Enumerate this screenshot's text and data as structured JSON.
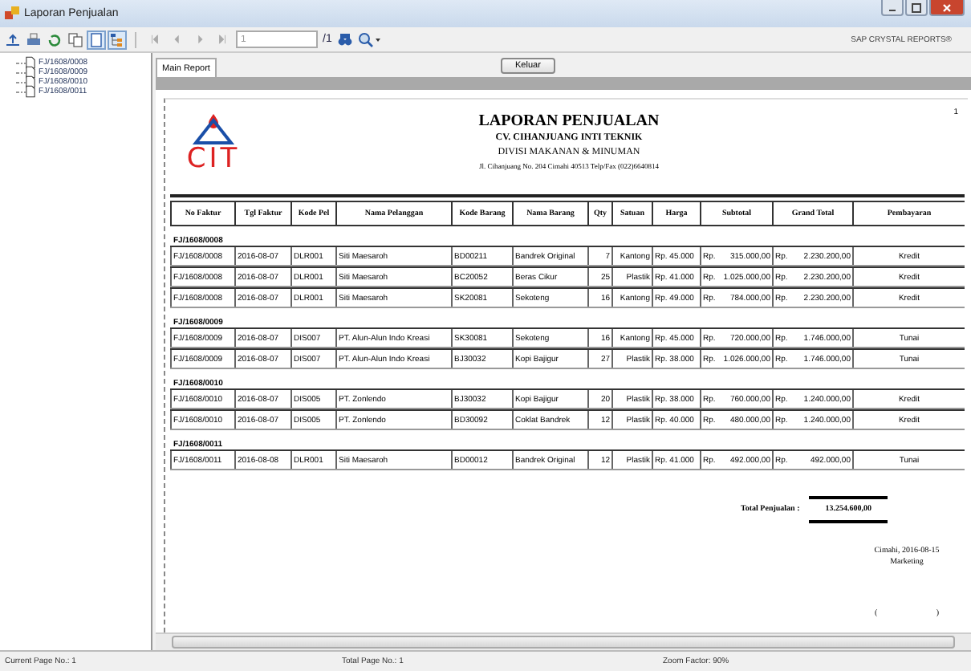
{
  "window": {
    "title": "Laporan Penjualan"
  },
  "toolbar": {
    "page_input": "1",
    "page_total": "/1",
    "brand": "SAP CRYSTAL REPORTS®"
  },
  "tree": [
    {
      "label": "FJ/1608/0008"
    },
    {
      "label": "FJ/1608/0009"
    },
    {
      "label": "FJ/1608/0010"
    },
    {
      "label": "FJ/1608/0011"
    }
  ],
  "tabs": [
    {
      "label": "Main Report",
      "selected": true
    }
  ],
  "exit_button": "Keluar",
  "report": {
    "logo_text": "CIT",
    "page_number": "1",
    "title": "LAPORAN PENJUALAN",
    "company": "CV. CIHANJUANG INTI TEKNIK",
    "division": "DIVISI MAKANAN & MINUMAN",
    "address": "Jl. Cihanjuang No. 204 Cimahi 40513 Telp/Fax (022)6640814",
    "columns": [
      "No Faktur",
      "Tgl Faktur",
      "Kode Pel",
      "Nama Pelanggan",
      "Kode Barang",
      "Nama Barang",
      "Qty",
      "Satuan",
      "Harga",
      "Subtotal",
      "Grand Total",
      "Pembayaran"
    ],
    "groups": [
      {
        "label": "FJ/1608/0008",
        "rows": [
          [
            "FJ/1608/0008",
            "2016-08-07",
            "DLR001",
            "Siti Maesaroh",
            "BD00211",
            "Bandrek Original",
            "7",
            "Kantong",
            "Rp.  45.000",
            "Rp.",
            "315.000,00",
            "Rp.",
            "2.230.200,00",
            "Kredit"
          ],
          [
            "FJ/1608/0008",
            "2016-08-07",
            "DLR001",
            "Siti Maesaroh",
            "BC20052",
            "Beras Cikur",
            "25",
            "Plastik",
            "Rp.  41.000",
            "Rp.",
            "1.025.000,00",
            "Rp.",
            "2.230.200,00",
            "Kredit"
          ],
          [
            "FJ/1608/0008",
            "2016-08-07",
            "DLR001",
            "Siti Maesaroh",
            "SK20081",
            "Sekoteng",
            "16",
            "Kantong",
            "Rp.  49.000",
            "Rp.",
            "784.000,00",
            "Rp.",
            "2.230.200,00",
            "Kredit"
          ]
        ]
      },
      {
        "label": "FJ/1608/0009",
        "rows": [
          [
            "FJ/1608/0009",
            "2016-08-07",
            "DIS007",
            "PT. Alun-Alun Indo Kreasi",
            "SK30081",
            "Sekoteng",
            "16",
            "Kantong",
            "Rp.  45.000",
            "Rp.",
            "720.000,00",
            "Rp.",
            "1.746.000,00",
            "Tunai"
          ],
          [
            "FJ/1608/0009",
            "2016-08-07",
            "DIS007",
            "PT. Alun-Alun Indo Kreasi",
            "BJ30032",
            "Kopi Bajigur",
            "27",
            "Plastik",
            "Rp.  38.000",
            "Rp.",
            "1.026.000,00",
            "Rp.",
            "1.746.000,00",
            "Tunai"
          ]
        ]
      },
      {
        "label": "FJ/1608/0010",
        "rows": [
          [
            "FJ/1608/0010",
            "2016-08-07",
            "DIS005",
            "PT. Zonlendo",
            "BJ30032",
            "Kopi Bajigur",
            "20",
            "Plastik",
            "Rp.  38.000",
            "Rp.",
            "760.000,00",
            "Rp.",
            "1.240.000,00",
            "Kredit"
          ],
          [
            "FJ/1608/0010",
            "2016-08-07",
            "DIS005",
            "PT. Zonlendo",
            "BD30092",
            "Coklat Bandrek",
            "12",
            "Plastik",
            "Rp.  40.000",
            "Rp.",
            "480.000,00",
            "Rp.",
            "1.240.000,00",
            "Kredit"
          ]
        ]
      },
      {
        "label": "FJ/1608/0011",
        "rows": [
          [
            "FJ/1608/0011",
            "2016-08-08",
            "DLR001",
            "Siti Maesaroh",
            "BD00012",
            "Bandrek Original",
            "12",
            "Plastik",
            "Rp.  41.000",
            "Rp.",
            "492.000,00",
            "Rp.",
            "492.000,00",
            "Tunai"
          ]
        ]
      }
    ],
    "total_label": "Total Penjualan :",
    "total_value": "13.254.600,00",
    "place_date": "Cimahi, 2016-08-15",
    "role": "Marketing",
    "sign_open": "(",
    "sign_close": ")"
  },
  "status_bar": [
    "Current Page No.: 1",
    "Total Page No.: 1",
    "Zoom Factor: 90%"
  ]
}
